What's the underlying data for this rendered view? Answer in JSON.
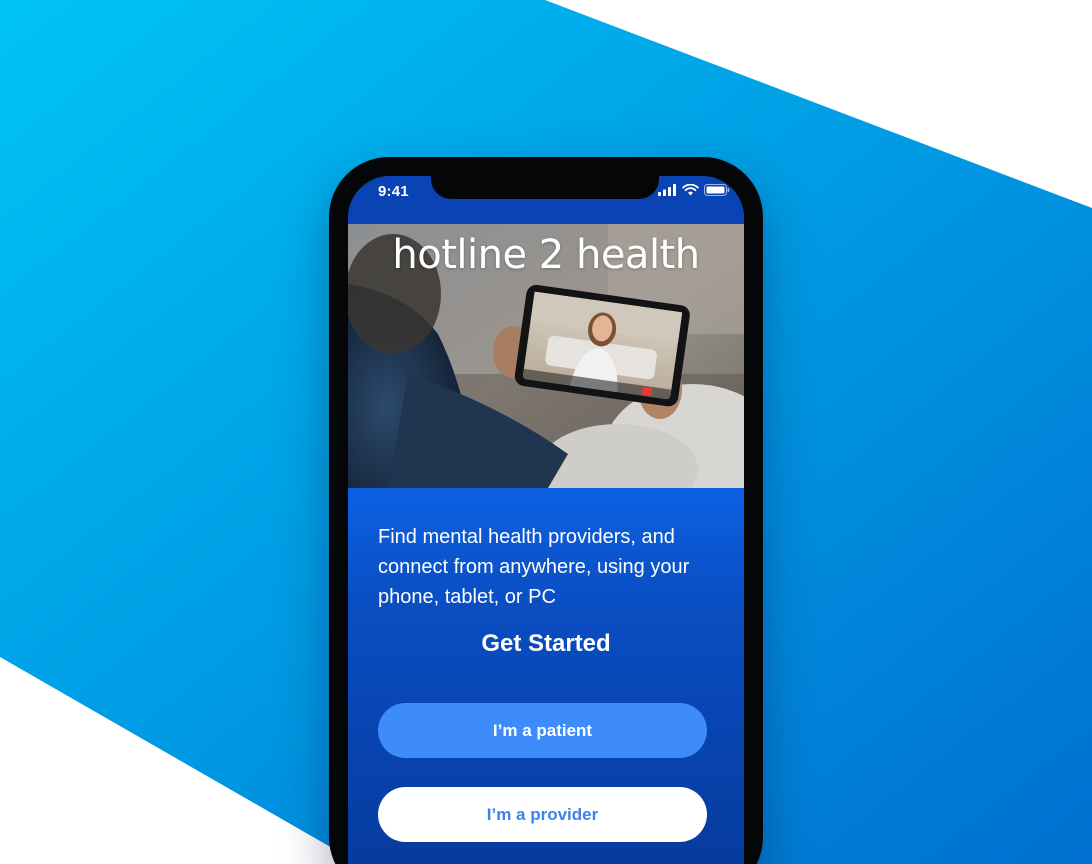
{
  "status_bar": {
    "time": "9:41",
    "icons": [
      "cellular-signal-icon",
      "wifi-icon",
      "battery-icon"
    ]
  },
  "hero": {
    "brand_title": "hotline 2 health",
    "image": "person-on-video-call-with-tablet"
  },
  "content": {
    "intro_text": "Find mental health providers, and connect from anywhere, using your phone, tablet, or PC",
    "cta_heading": "Get Started",
    "patient_button_label": "I’m a patient",
    "provider_button_label": "I’m a provider"
  },
  "colors": {
    "background_gradient_start": "#00c2f5",
    "background_gradient_end": "#0075d4",
    "status_bar": "#0a43b3",
    "screen_top": "#0d63e6",
    "screen_bottom": "#06389a",
    "patient_button": "#3e8cfb",
    "provider_button": "#ffffff",
    "provider_button_text": "#3b82ec"
  }
}
